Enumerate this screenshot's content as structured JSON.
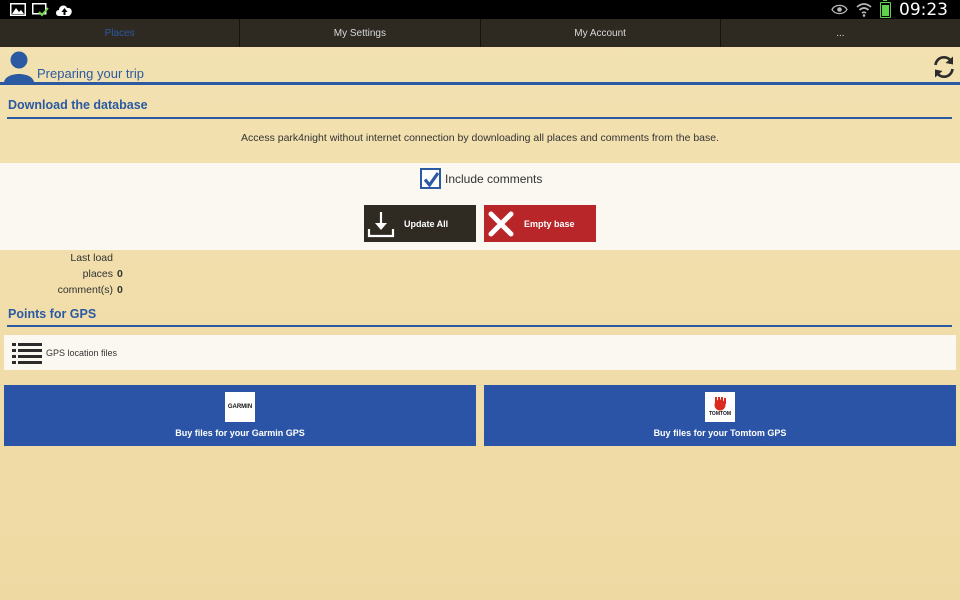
{
  "status_bar": {
    "time": "09:23",
    "icons": [
      "image-icon",
      "sync-check-icon",
      "cloud-upload-icon",
      "eye-icon",
      "wifi-icon",
      "battery-icon"
    ]
  },
  "tabs": [
    {
      "label": "Places",
      "active": true
    },
    {
      "label": "My Settings",
      "active": false
    },
    {
      "label": "My Account",
      "active": false
    },
    {
      "label": "...",
      "active": false
    }
  ],
  "header": {
    "title": "Preparing your trip"
  },
  "download_section": {
    "title": "Download the database",
    "description": "Access park4night without internet connection by downloading all places and comments from the base.",
    "include_comments_label": "Include comments",
    "include_comments_checked": true,
    "update_all_label": "Update All",
    "empty_base_label": "Empty base",
    "stats": {
      "last_load_label": "Last load",
      "last_load_value": "",
      "places_label": "places",
      "places_value": "0",
      "comments_label": "comment(s)",
      "comments_value": "0"
    }
  },
  "gps_section": {
    "title": "Points for GPS",
    "files_label": "GPS location files",
    "garmin": {
      "logo_text": "GARMIN",
      "label": "Buy files for your Garmin GPS"
    },
    "tomtom": {
      "logo_text": "TOMTOM",
      "label": "Buy files for your Tomtom GPS"
    }
  },
  "colors": {
    "accent": "#2b5aa3",
    "danger": "#b9262a",
    "dark": "#2f2a22",
    "background": "#f1dfac"
  }
}
